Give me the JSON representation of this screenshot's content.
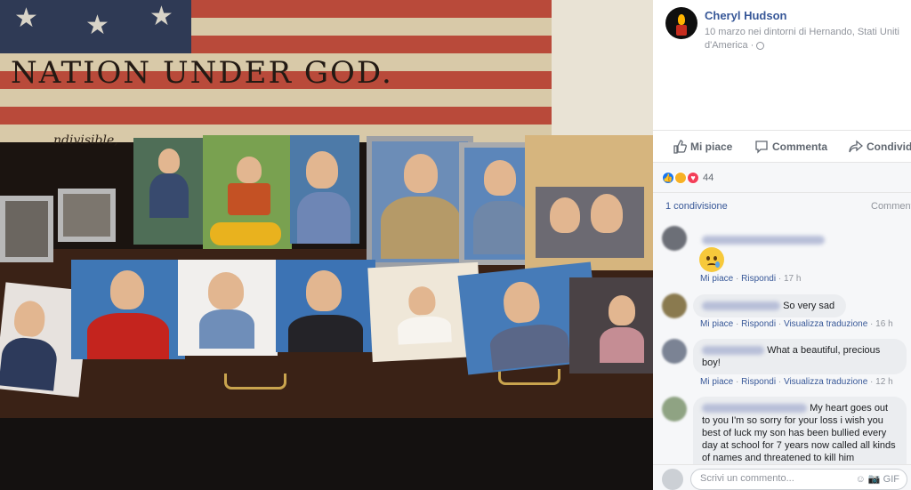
{
  "post": {
    "author": "Cheryl Hudson",
    "meta_line1": "10 marzo nei dintorni di Hernando, Stati Uniti",
    "meta_line2": "d'America · "
  },
  "photo": {
    "motto": "NATION UNDER GOD.",
    "script": "ndivisible,"
  },
  "actions": {
    "like": "Mi piace",
    "comment": "Commenta",
    "share": "Condividi"
  },
  "reactions": {
    "count": "44",
    "icons": [
      "like-icon",
      "sad-icon",
      "love-icon"
    ],
    "colors": {
      "like": "#1877f2",
      "sad": "#f7b125",
      "love": "#f33e58"
    }
  },
  "shares": {
    "label": "1 condivisione",
    "comments_label": "Commenti"
  },
  "comments": [
    {
      "text": "",
      "time": "17 h",
      "actions": [
        "Mi piace",
        "Rispondi"
      ]
    },
    {
      "text": "So very sad",
      "time": "16 h",
      "actions": [
        "Mi piace",
        "Rispondi",
        "Visualizza traduzione"
      ]
    },
    {
      "text": "What a beautiful, precious boy!",
      "time": "12 h",
      "actions": [
        "Mi piace",
        "Rispondi",
        "Visualizza traduzione"
      ]
    },
    {
      "text_first": "My heart goes out",
      "text_rest": "to you I'm so sorry for your loss i wish you best of luck my son has been bullied every day at school for 7 years now called all kinds of names and threatened to kill him"
    }
  ],
  "composer": {
    "placeholder": "Scrivi un commento...",
    "gif_label": "GIF"
  },
  "colors": {
    "link": "#385898",
    "muted": "#90949c",
    "bubble": "#ebedf0"
  }
}
